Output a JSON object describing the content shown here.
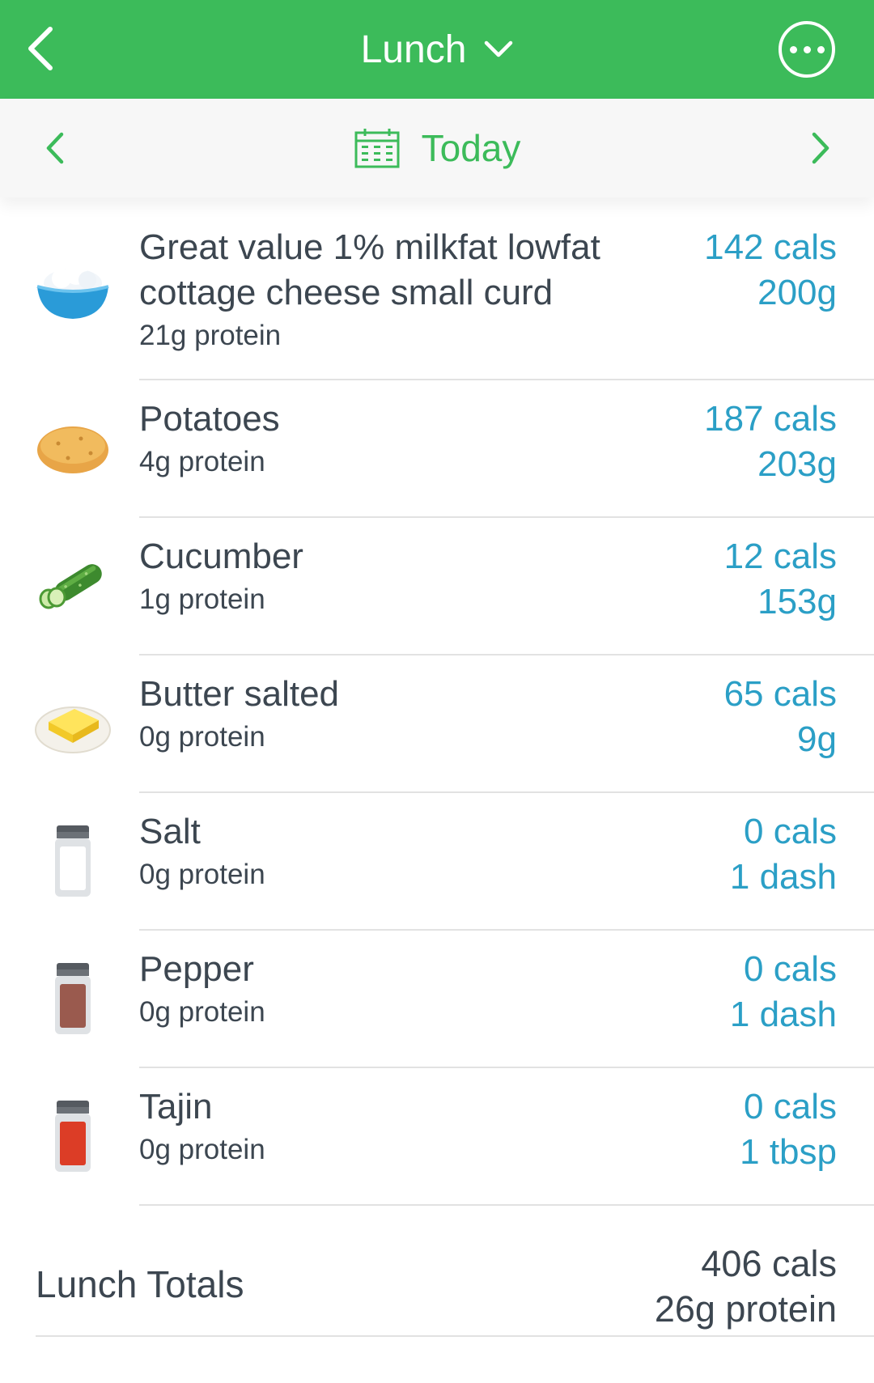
{
  "header": {
    "title": "Lunch",
    "back_icon": "chevron-left-icon",
    "title_icon": "chevron-down-icon",
    "more_icon": "more-horizontal-icon",
    "background_color": "#3cbb5a"
  },
  "date_bar": {
    "label": "Today",
    "calendar_icon": "calendar-icon",
    "accent_color": "#3cbb5a"
  },
  "foods": [
    {
      "name": "Great value 1% milkfat lowfat cottage cheese small curd",
      "protein": "21g protein",
      "calories": "142 cals",
      "amount": "200g",
      "icon": "cottage-cheese-bowl-icon"
    },
    {
      "name": "Potatoes",
      "protein": "4g protein",
      "calories": "187 cals",
      "amount": "203g",
      "icon": "potato-icon"
    },
    {
      "name": "Cucumber",
      "protein": "1g protein",
      "calories": "12 cals",
      "amount": "153g",
      "icon": "cucumber-icon"
    },
    {
      "name": "Butter salted",
      "protein": "0g protein",
      "calories": "65 cals",
      "amount": "9g",
      "icon": "butter-icon"
    },
    {
      "name": "Salt",
      "protein": "0g protein",
      "calories": "0 cals",
      "amount": "1 dash",
      "icon": "salt-shaker-icon"
    },
    {
      "name": "Pepper",
      "protein": "0g protein",
      "calories": "0 cals",
      "amount": "1 dash",
      "icon": "pepper-shaker-icon"
    },
    {
      "name": "Tajin",
      "protein": "0g protein",
      "calories": "0 cals",
      "amount": "1 tbsp",
      "icon": "tajin-shaker-icon"
    }
  ],
  "totals": {
    "label": "Lunch Totals",
    "calories": "406 cals",
    "protein": "26g protein"
  },
  "colors": {
    "value_blue": "#2b9fc6",
    "text_dark": "#3c4650"
  }
}
